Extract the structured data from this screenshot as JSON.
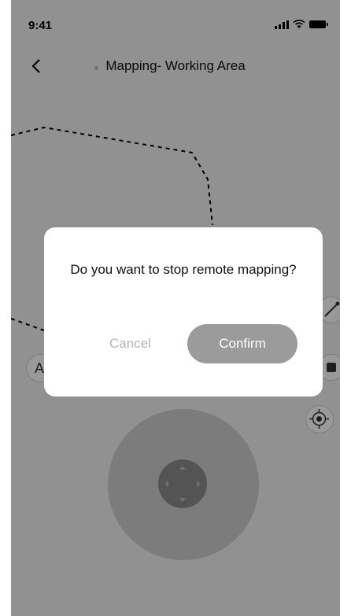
{
  "status_bar": {
    "time": "9:41"
  },
  "nav": {
    "title": "Mapping- Working Area"
  },
  "left_chip": {
    "label": "A"
  },
  "dialog": {
    "message": "Do you want to stop remote mapping?",
    "cancel_label": "Cancel",
    "confirm_label": "Confirm"
  },
  "icons": [
    "signal-icon",
    "wifi-icon",
    "battery-icon",
    "back-icon",
    "edit-line-icon",
    "stop-icon",
    "locate-icon",
    "arrow-up-icon",
    "arrow-down-icon",
    "arrow-left-icon",
    "arrow-right-icon"
  ],
  "colors": {
    "overlay": "#000000",
    "confirm_button": "#9b9b9b",
    "cancel_text": "#b5b5b5"
  }
}
